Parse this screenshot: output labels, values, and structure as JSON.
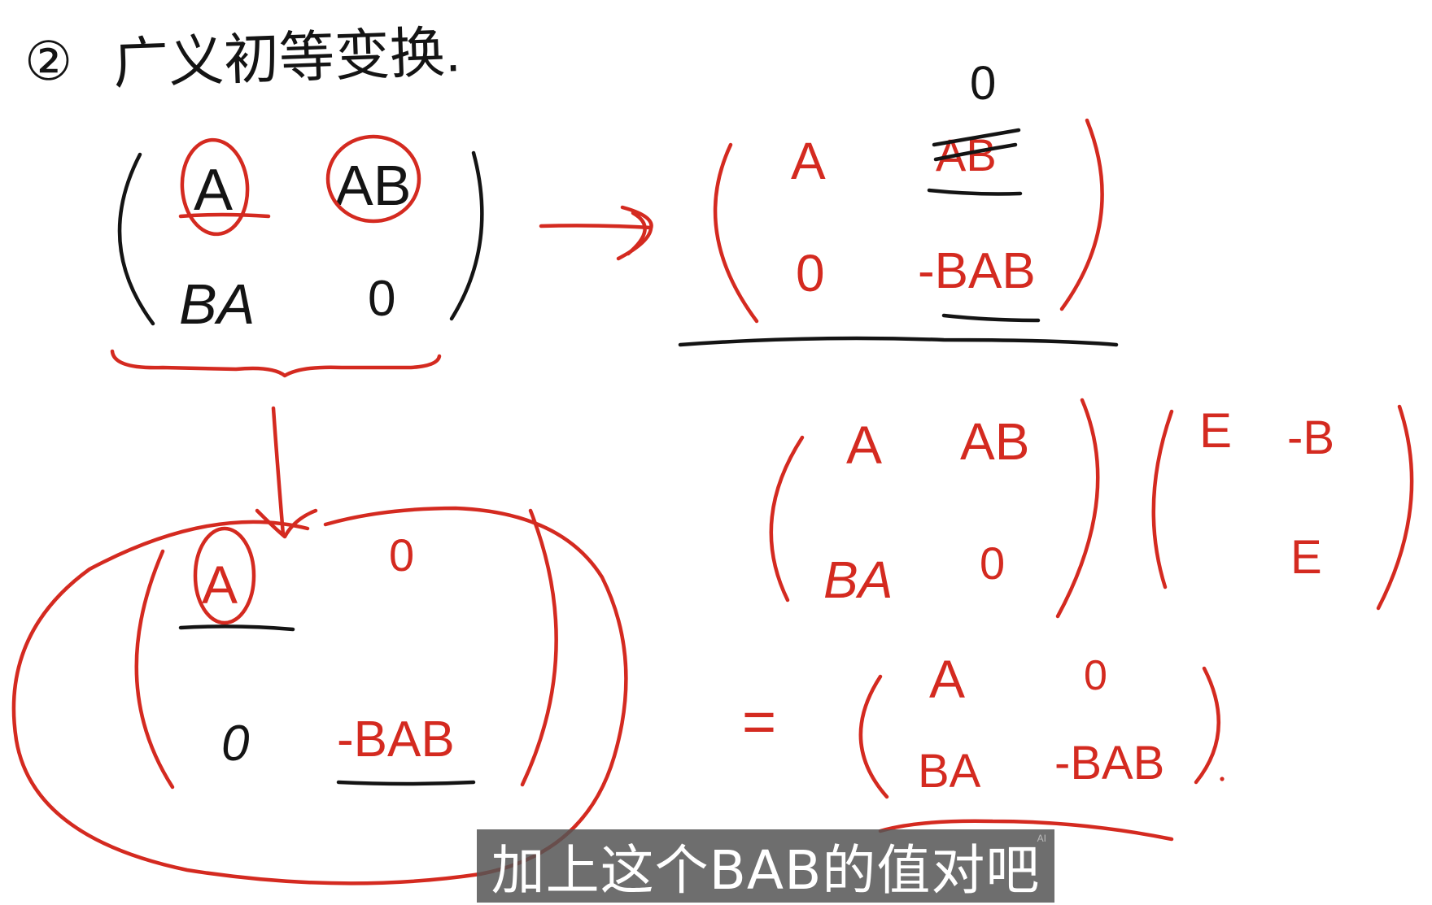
{
  "heading": {
    "number": "②",
    "title": "广义初等变换."
  },
  "matrix_start": {
    "a": "A",
    "b": "AB",
    "c": "BA",
    "d": "0"
  },
  "matrix_right": {
    "a": "A",
    "b_struck": "AB",
    "b_new": "0",
    "c": "0",
    "d": "-BAB"
  },
  "matrix_down": {
    "a": "A",
    "b": "0",
    "c": "0",
    "d": "-BAB"
  },
  "product": {
    "m1": {
      "a": "A",
      "b": "AB",
      "c": "BA",
      "d": "0"
    },
    "m2": {
      "a": "E",
      "b": "-B",
      "d": "E"
    },
    "equals": "=",
    "result": {
      "a": "A",
      "b": "0",
      "c": "BA",
      "d": "-BAB"
    }
  },
  "subtitle": {
    "text": "加上这个BAB的值对吧",
    "badge": "AI"
  }
}
